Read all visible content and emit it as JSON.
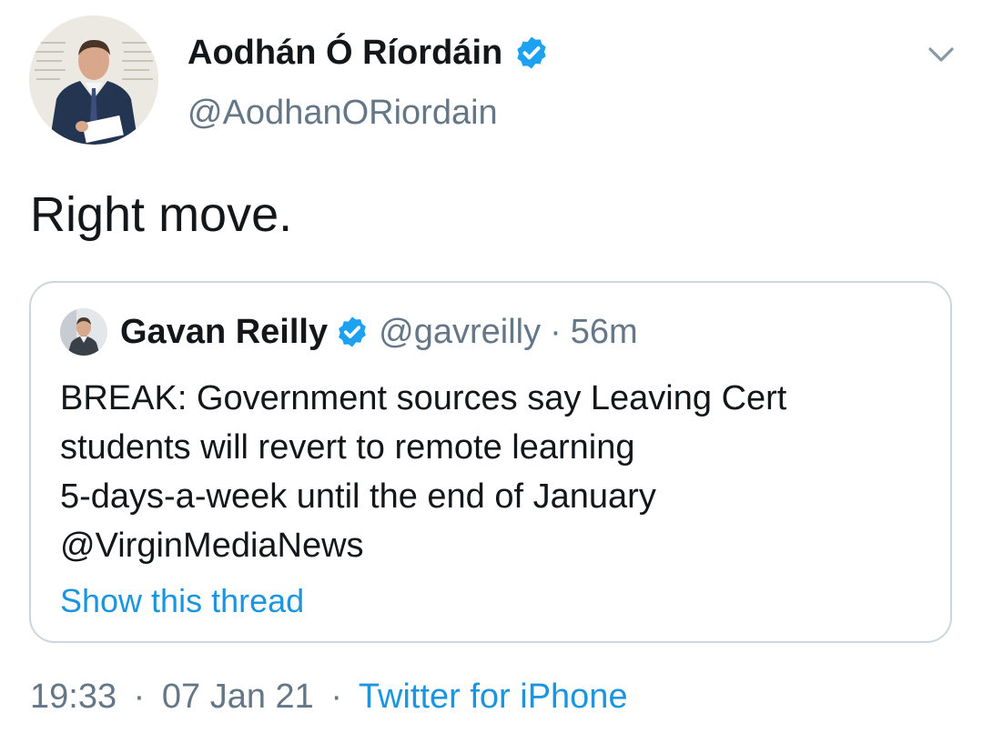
{
  "author": {
    "name": "Aodhán Ó Ríordáin",
    "handle": "@AodhanORiordain",
    "verified": true
  },
  "tweet": {
    "text": "Right move."
  },
  "quoted_tweet": {
    "name": "Gavan Reilly",
    "handle": "@gavreilly",
    "separator": "·",
    "time": "56m",
    "verified": true,
    "lines": [
      "BREAK: Government sources say Leaving Cert",
      "students will revert to remote learning",
      "5-days-a-week until the end of January",
      "@VirginMediaNews"
    ],
    "show_thread_label": "Show this thread"
  },
  "footer": {
    "time": "19:33",
    "separator": "·",
    "date": "07 Jan 21",
    "source": "Twitter for iPhone"
  },
  "icons": {
    "menu": "chevron-down-icon",
    "verified": "verified-badge-icon"
  },
  "colors": {
    "text": "#14171a",
    "secondary": "#657786",
    "link": "#1b95e0",
    "verified": "#1da1f2",
    "border": "#ccd6dd"
  }
}
